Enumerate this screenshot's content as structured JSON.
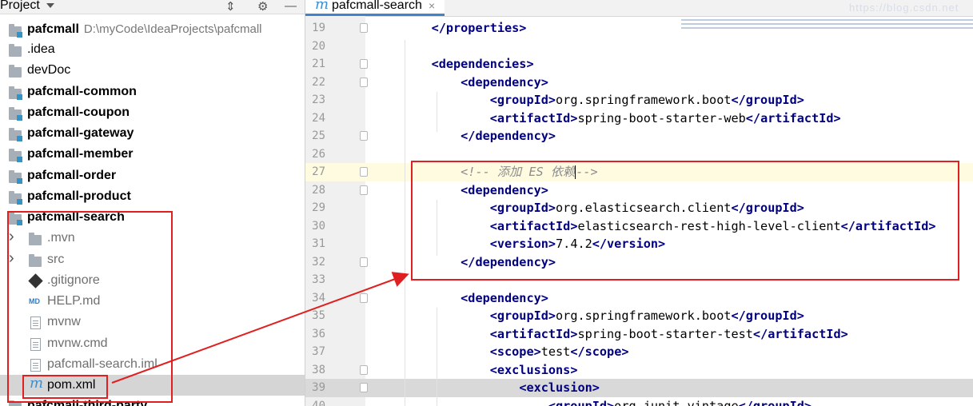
{
  "project_panel": {
    "title": "Project",
    "tree": [
      {
        "label": "pafcmall",
        "path": "D:\\myCode\\IdeaProjects\\pafcmall",
        "icon": "module-folder-icon",
        "bold": true
      },
      {
        "label": ".idea",
        "icon": "folder-icon"
      },
      {
        "label": "devDoc",
        "icon": "folder-icon"
      },
      {
        "label": "pafcmall-common",
        "icon": "module-folder-icon",
        "bold": true
      },
      {
        "label": "pafcmall-coupon",
        "icon": "module-folder-icon",
        "bold": true
      },
      {
        "label": "pafcmall-gateway",
        "icon": "module-folder-icon",
        "bold": true
      },
      {
        "label": "pafcmall-member",
        "icon": "module-folder-icon",
        "bold": true
      },
      {
        "label": "pafcmall-order",
        "icon": "module-folder-icon",
        "bold": true
      },
      {
        "label": "pafcmall-product",
        "icon": "module-folder-icon",
        "bold": true
      },
      {
        "label": "pafcmall-search",
        "icon": "module-folder-icon",
        "bold": true
      },
      {
        "label": ".mvn",
        "icon": "folder-icon",
        "expandable": true
      },
      {
        "label": "src",
        "icon": "folder-icon",
        "expandable": true
      },
      {
        "label": ".gitignore",
        "icon": "git-icon"
      },
      {
        "label": "HELP.md",
        "icon": "markdown-icon"
      },
      {
        "label": "mvnw",
        "icon": "text-file-icon"
      },
      {
        "label": "mvnw.cmd",
        "icon": "text-file-icon"
      },
      {
        "label": "pafcmall-search.iml",
        "icon": "iml-file-icon"
      },
      {
        "label": "pom.xml",
        "icon": "maven-icon",
        "selected": true
      },
      {
        "label": "pafcmall-third-party",
        "icon": "module-folder-icon",
        "bold": true
      }
    ]
  },
  "editor": {
    "tab": {
      "label": "pafcmall-search",
      "icon": "maven-icon",
      "close": "×"
    },
    "watermark": "https://blog.csdn.net",
    "lines": [
      {
        "n": "19",
        "segments": [
          {
            "text": "    ",
            "cls": ""
          },
          {
            "text": "</properties>",
            "cls": "t"
          }
        ]
      },
      {
        "n": "20",
        "segments": []
      },
      {
        "n": "21",
        "segments": [
          {
            "text": "    ",
            "cls": ""
          },
          {
            "text": "<dependencies>",
            "cls": "t"
          }
        ]
      },
      {
        "n": "22",
        "segments": [
          {
            "text": "        ",
            "cls": ""
          },
          {
            "text": "<dependency>",
            "cls": "t"
          }
        ]
      },
      {
        "n": "23",
        "segments": [
          {
            "text": "            ",
            "cls": ""
          },
          {
            "text": "<groupId>",
            "cls": "t"
          },
          {
            "text": "org.springframework.boot",
            "cls": ""
          },
          {
            "text": "</groupId>",
            "cls": "t"
          }
        ]
      },
      {
        "n": "24",
        "segments": [
          {
            "text": "            ",
            "cls": ""
          },
          {
            "text": "<artifactId>",
            "cls": "t"
          },
          {
            "text": "spring-boot-starter-web",
            "cls": ""
          },
          {
            "text": "</artifactId>",
            "cls": "t"
          }
        ]
      },
      {
        "n": "25",
        "segments": [
          {
            "text": "        ",
            "cls": ""
          },
          {
            "text": "</dependency>",
            "cls": "t"
          }
        ]
      },
      {
        "n": "26",
        "segments": []
      },
      {
        "n": "27",
        "segments": [
          {
            "text": "        ",
            "cls": ""
          },
          {
            "text": "<!-- 添加 ES 依赖",
            "cls": "c"
          },
          {
            "text": "-->",
            "cls": "c"
          }
        ]
      },
      {
        "n": "28",
        "segments": [
          {
            "text": "        ",
            "cls": ""
          },
          {
            "text": "<dependency>",
            "cls": "t"
          }
        ]
      },
      {
        "n": "29",
        "segments": [
          {
            "text": "            ",
            "cls": ""
          },
          {
            "text": "<groupId>",
            "cls": "t"
          },
          {
            "text": "org.elasticsearch.client",
            "cls": ""
          },
          {
            "text": "</groupId>",
            "cls": "t"
          }
        ]
      },
      {
        "n": "30",
        "segments": [
          {
            "text": "            ",
            "cls": ""
          },
          {
            "text": "<artifactId>",
            "cls": "t"
          },
          {
            "text": "elasticsearch-rest-high-level-client",
            "cls": ""
          },
          {
            "text": "</artifactId>",
            "cls": "t"
          }
        ]
      },
      {
        "n": "31",
        "segments": [
          {
            "text": "            ",
            "cls": ""
          },
          {
            "text": "<version>",
            "cls": "t"
          },
          {
            "text": "7.4.2",
            "cls": ""
          },
          {
            "text": "</version>",
            "cls": "t"
          }
        ]
      },
      {
        "n": "32",
        "segments": [
          {
            "text": "        ",
            "cls": ""
          },
          {
            "text": "</dependency>",
            "cls": "t"
          }
        ]
      },
      {
        "n": "33",
        "segments": []
      },
      {
        "n": "34",
        "segments": [
          {
            "text": "        ",
            "cls": ""
          },
          {
            "text": "<dependency>",
            "cls": "t"
          }
        ]
      },
      {
        "n": "35",
        "segments": [
          {
            "text": "            ",
            "cls": ""
          },
          {
            "text": "<groupId>",
            "cls": "t"
          },
          {
            "text": "org.springframework.boot",
            "cls": ""
          },
          {
            "text": "</groupId>",
            "cls": "t"
          }
        ]
      },
      {
        "n": "36",
        "segments": [
          {
            "text": "            ",
            "cls": ""
          },
          {
            "text": "<artifactId>",
            "cls": "t"
          },
          {
            "text": "spring-boot-starter-test",
            "cls": ""
          },
          {
            "text": "</artifactId>",
            "cls": "t"
          }
        ]
      },
      {
        "n": "37",
        "segments": [
          {
            "text": "            ",
            "cls": ""
          },
          {
            "text": "<scope>",
            "cls": "t"
          },
          {
            "text": "test",
            "cls": ""
          },
          {
            "text": "</scope>",
            "cls": "t"
          }
        ]
      },
      {
        "n": "38",
        "segments": [
          {
            "text": "            ",
            "cls": ""
          },
          {
            "text": "<exclusions>",
            "cls": "t"
          }
        ]
      },
      {
        "n": "39",
        "segments": [
          {
            "text": "                ",
            "cls": ""
          },
          {
            "text": "<exclusion>",
            "cls": "t"
          }
        ]
      },
      {
        "n": "40",
        "segments": [
          {
            "text": "                    ",
            "cls": ""
          },
          {
            "text": "<groupId>",
            "cls": "t"
          },
          {
            "text": "org.junit.vintage",
            "cls": ""
          },
          {
            "text": "</groupId>",
            "cls": "t"
          }
        ]
      }
    ]
  },
  "colors": {
    "annotation": "#e02020",
    "tag": "#000080",
    "comment": "#8c8c8c",
    "accent": "#4083c9"
  }
}
